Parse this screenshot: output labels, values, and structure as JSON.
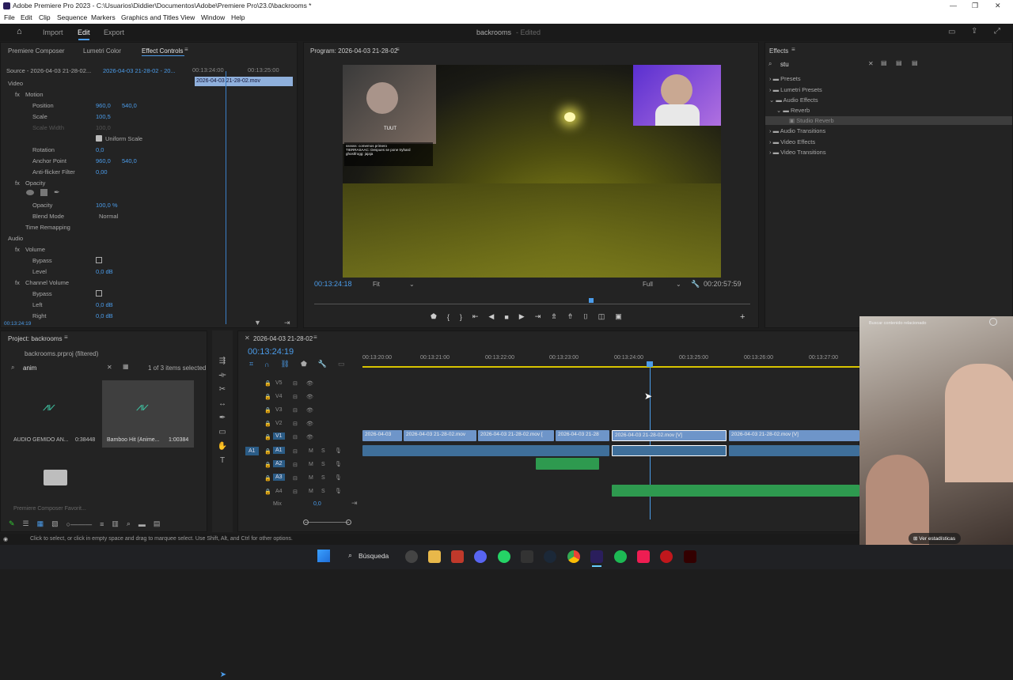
{
  "window": {
    "title": "Adobe Premiere Pro 2023 - C:\\Usuarios\\Diddier\\Documentos\\Adobe\\Premiere Pro\\23.0\\backrooms *"
  },
  "menu": [
    "File",
    "Edit",
    "Clip",
    "Sequence",
    "Markers",
    "Graphics and Titles",
    "View",
    "Window",
    "Help"
  ],
  "workspace": {
    "import": "Import",
    "edit": "Edit",
    "export": "Export",
    "project_name": "backrooms",
    "edited": "- Edited"
  },
  "effect_controls": {
    "tabs": [
      "Premiere Composer",
      "Lumetri Color",
      "Effect Controls"
    ],
    "source": "Source - 2026-04-03 21-28-02...",
    "clip": "2026-04-03 21-28-02 - 20...",
    "time1": "00:13:24:00",
    "time2": "00:13:25:00",
    "clip_bar": "2026-04-03 21-28-02.mov",
    "video": "Video",
    "motion": "Motion",
    "position": "Position",
    "pos_x": "960,0",
    "pos_y": "540,0",
    "scale": "Scale",
    "scale_v": "100,5",
    "scale_width": "Scale Width",
    "scale_width_v": "100,0",
    "uniform": "Uniform Scale",
    "rotation": "Rotation",
    "rotation_v": "0,0",
    "anchor": "Anchor Point",
    "anc_x": "960,0",
    "anc_y": "540,0",
    "antiflicker": "Anti-flicker Filter",
    "antiflicker_v": "0,00",
    "opacity_h": "Opacity",
    "opacity": "Opacity",
    "opacity_v": "100,0 %",
    "blend": "Blend Mode",
    "blend_v": "Normal",
    "timeremap": "Time Remapping",
    "audio": "Audio",
    "volume": "Volume",
    "bypass": "Bypass",
    "level": "Level",
    "level_v": "0,0 dB",
    "channel": "Channel Volume",
    "bypass2": "Bypass",
    "left": "Left",
    "left_v": "0,0 dB",
    "right": "Right",
    "right_v": "0,0 dB",
    "bottom_time": "00:13:24:19"
  },
  "program": {
    "title": "Program: 2026-04-03 21-28-02",
    "timecode": "00:13:24:18",
    "fit": "Fit",
    "full": "Full",
    "duration": "00:20:57:59",
    "overlay_text": "TUUT",
    "chat": [
      "ssssss: comemos primero",
      "TIERRASAAC: Despues se pone tryhard",
      "ghostfrogg: jajaja"
    ]
  },
  "effects": {
    "title": "Effects",
    "search": "stu",
    "tree": [
      "Presets",
      "Lumetri Presets",
      "Audio Effects",
      "Reverb",
      "Studio Reverb",
      "Audio Transitions",
      "Video Effects",
      "Video Transitions"
    ]
  },
  "project": {
    "title": "Project: backrooms",
    "file": "backrooms.prproj (filtered)",
    "search": "anim",
    "count": "1 of 3 items selected",
    "items": [
      {
        "name": "AUDIO GEMIDO AN...",
        "dur": "0:38448"
      },
      {
        "name": "Bamboo Hit (Anime...",
        "dur": "1:00384"
      },
      {
        "name": "Premiere Composer Favorit..."
      }
    ]
  },
  "timeline": {
    "title": "2026-04-03 21-28-02",
    "timecode": "00:13:24:19",
    "ruler": [
      "00:13:20:00",
      "00:13:21:00",
      "00:13:22:00",
      "00:13:23:00",
      "00:13:24:00",
      "00:13:25:00",
      "00:13:26:00",
      "00:13:27:00"
    ],
    "tracks_v": [
      "V5",
      "V4",
      "V3",
      "V2",
      "V1"
    ],
    "tracks_a": [
      "A1",
      "A2",
      "A3",
      "A4"
    ],
    "mix": "Mix",
    "mix_v": "0,0",
    "clips": [
      "2026-04-03",
      "2026-04-03 21-28-02.mov",
      "2026-04-03 21-28-02.mov [",
      "2026-04-03 21-28",
      "2026-04-03 21-28-02.mov [V]",
      "2026-04-03 21-28-02.mov [V]"
    ]
  },
  "status": "Click to select, or click in empty space and drag to marquee select. Use Shift, Alt, and Ctrl for other options.",
  "webcam_overlay": {
    "header": "Buscar contenido relacionado",
    "stats": "Ver estadísticas"
  },
  "taskbar": {
    "search": "Búsqueda"
  }
}
